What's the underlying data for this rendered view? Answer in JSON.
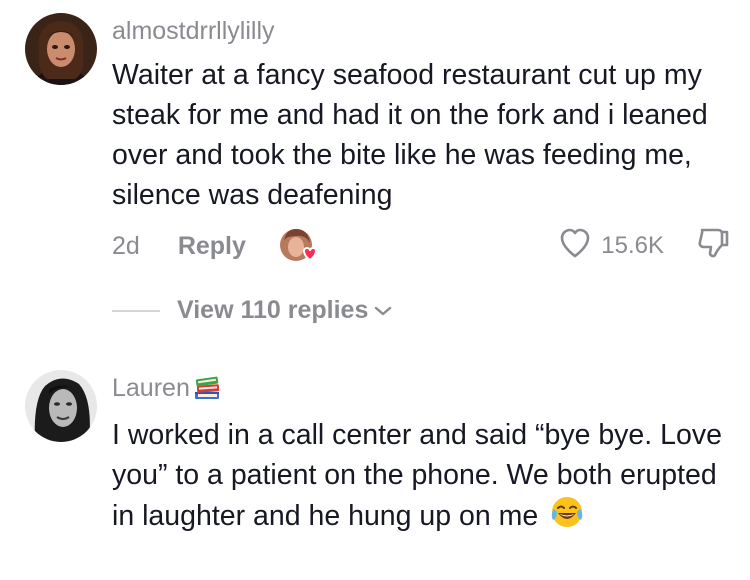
{
  "comments": [
    {
      "username": "almostdrrllylilly",
      "text": "Waiter at a fancy seafood restaurant cut up my steak for me and had it on the fork and i leaned over and took the bite like he was feeding me, silence was deafening",
      "age": "2d",
      "reply_label": "Reply",
      "likes": "15.6K",
      "view_replies_label": "View 110 replies"
    },
    {
      "username": "Lauren",
      "username_emoji": "books-emoji",
      "text": "I worked in a call center and said “bye bye. Love you” to a patient on the phone. We both erupted in laughter and he hung up on me",
      "trailing_emoji": "tears-of-joy-emoji"
    }
  ],
  "colors": {
    "text": "#161823",
    "secondary": "#8a8b91",
    "heart_badge": "#fe2c55"
  }
}
